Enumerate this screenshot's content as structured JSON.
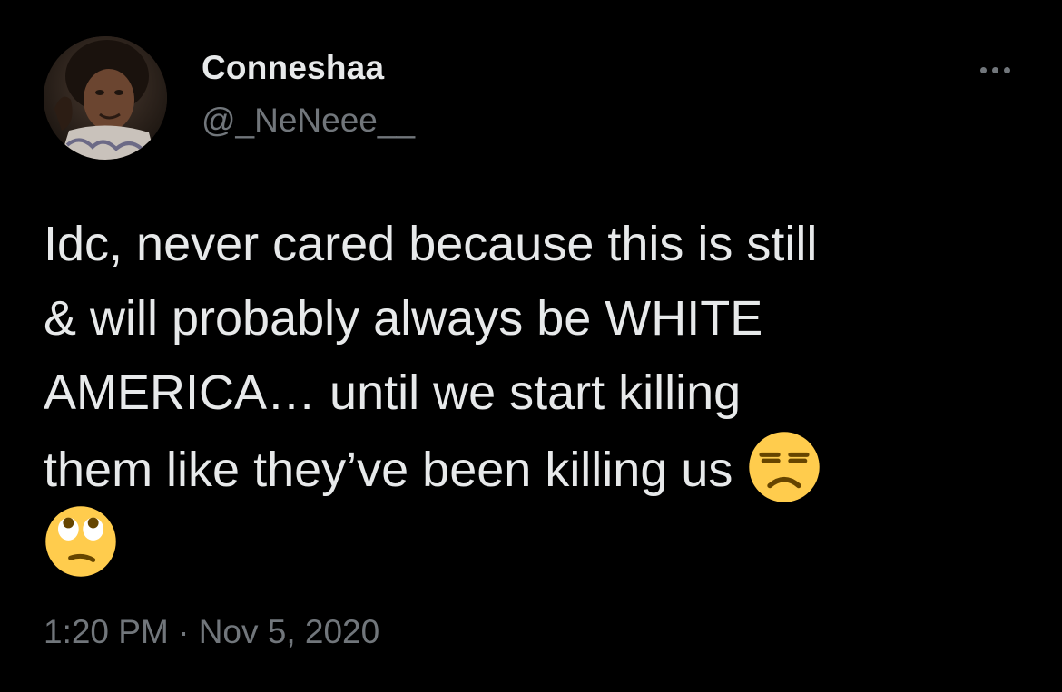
{
  "tweet": {
    "author": {
      "display_name": "Conneshaa",
      "handle": "@_NeNeee__"
    },
    "text_lines": [
      "Idc, never cared because this is still",
      "& will probably always be WHITE",
      "AMERICA… until we start killing",
      "them like they’ve been killing us"
    ],
    "emojis": [
      "unamused-face-emoji",
      "face-with-rolling-eyes-emoji"
    ],
    "time": "1:20 PM",
    "separator": "·",
    "date": "Nov 5, 2020"
  },
  "colors": {
    "background": "#000000",
    "primary_text": "#e7e9ea",
    "secondary_text": "#71767b",
    "emoji_yellow": "#ffcc4d"
  },
  "icons": {
    "more": "more-horizontal-icon"
  }
}
